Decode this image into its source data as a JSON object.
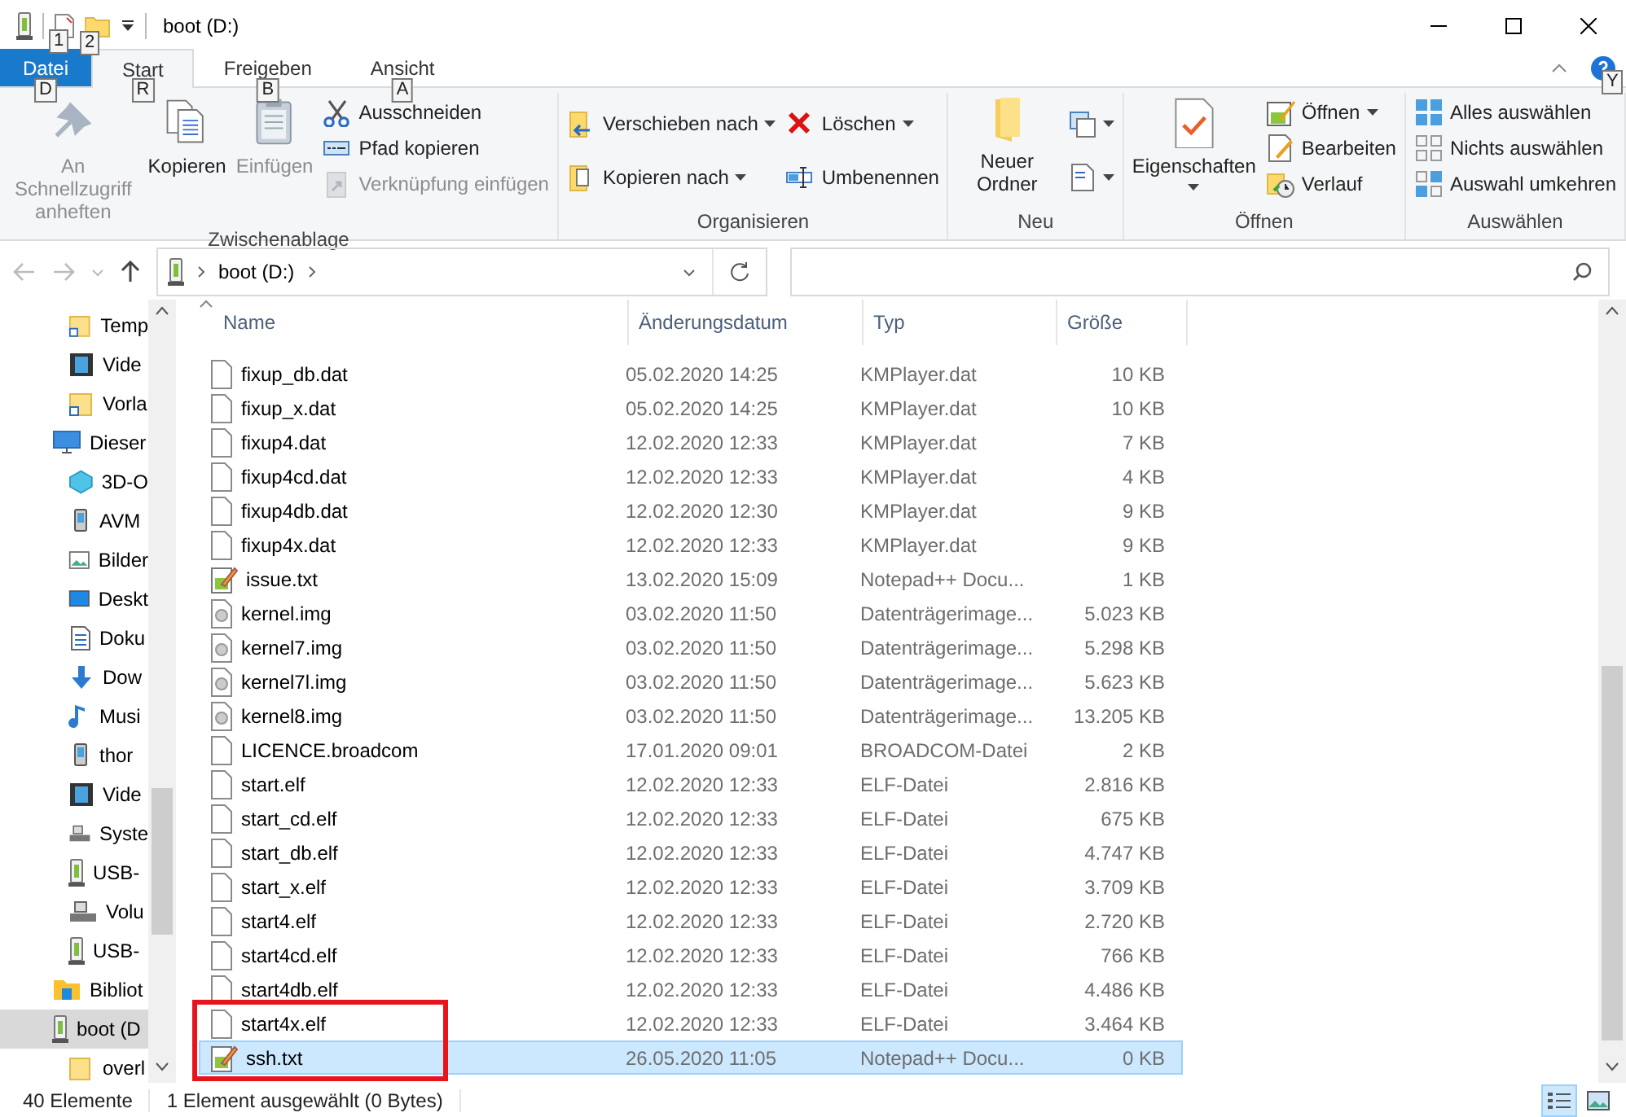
{
  "title_bar": {
    "title": "boot (D:)",
    "quick_access": [
      {
        "keytip": "1"
      },
      {
        "keytip": "2"
      }
    ]
  },
  "ribbon_tabs": [
    {
      "label": "Datei",
      "kind": "file",
      "selected": false,
      "keytip": "D"
    },
    {
      "label": "Start",
      "kind": "tab",
      "selected": true,
      "keytip": "R"
    },
    {
      "label": "Freigeben",
      "kind": "tab",
      "selected": false,
      "keytip": "B"
    },
    {
      "label": "Ansicht",
      "kind": "tab",
      "selected": false,
      "keytip": "A"
    }
  ],
  "help": {
    "keytip": "Y"
  },
  "ribbon_groups": [
    {
      "label": "Zwischenablage",
      "columns": [
        {
          "kind": "large",
          "buttons": [
            {
              "label": "An Schnellzugriff anheften",
              "disabled": true,
              "dropdown": false
            }
          ]
        },
        {
          "kind": "large",
          "buttons": [
            {
              "label": "Kopieren",
              "disabled": false,
              "dropdown": false
            }
          ]
        },
        {
          "kind": "large",
          "buttons": [
            {
              "label": "Einfügen",
              "disabled": true,
              "dropdown": false
            }
          ]
        },
        {
          "kind": "stack",
          "buttons": [
            {
              "label": "Ausschneiden",
              "disabled": false,
              "dropdown": false
            },
            {
              "label": "Pfad kopieren",
              "disabled": false,
              "dropdown": false
            },
            {
              "label": "Verknüpfung einfügen",
              "disabled": true,
              "dropdown": false
            }
          ]
        }
      ]
    },
    {
      "label": "Organisieren",
      "columns": [
        {
          "kind": "stack2",
          "buttons": [
            {
              "label": "Verschieben nach",
              "disabled": false,
              "dropdown": true
            },
            {
              "label": "Kopieren nach",
              "disabled": false,
              "dropdown": true
            }
          ]
        },
        {
          "kind": "stack2",
          "buttons": [
            {
              "label": "Löschen",
              "disabled": false,
              "dropdown": true
            },
            {
              "label": "Umbenennen",
              "disabled": false,
              "dropdown": false
            }
          ]
        }
      ]
    },
    {
      "label": "Neu",
      "columns": [
        {
          "kind": "large",
          "buttons": [
            {
              "label": "Neuer Ordner",
              "disabled": false,
              "dropdown": false
            }
          ]
        },
        {
          "kind": "stack2",
          "buttons": [
            {
              "disabled": false,
              "dropdown": true
            },
            {
              "disabled": false,
              "dropdown": true
            }
          ]
        }
      ]
    },
    {
      "label": "Öffnen",
      "columns": [
        {
          "kind": "large",
          "buttons": [
            {
              "label": "Eigenschaften",
              "disabled": false,
              "dropdown": true
            }
          ]
        },
        {
          "kind": "stack",
          "buttons": [
            {
              "label": "Öffnen",
              "disabled": false,
              "dropdown": true
            },
            {
              "label": "Bearbeiten",
              "disabled": false,
              "dropdown": false
            },
            {
              "label": "Verlauf",
              "disabled": false,
              "dropdown": false
            }
          ]
        }
      ]
    },
    {
      "label": "Auswählen",
      "columns": [
        {
          "kind": "stack",
          "buttons": [
            {
              "label": "Alles auswählen",
              "disabled": false,
              "dropdown": false
            },
            {
              "label": "Nichts auswählen",
              "disabled": false,
              "dropdown": false
            },
            {
              "label": "Auswahl umkehren",
              "disabled": false,
              "dropdown": false
            }
          ]
        }
      ]
    }
  ],
  "address": {
    "crumbs": [
      "boot (D:)"
    ]
  },
  "sidebar": {
    "quick_access_items": [
      {
        "label": "Temp",
        "kind": "shortcut",
        "selected": false
      },
      {
        "label": "Vide",
        "kind": "video",
        "selected": false
      },
      {
        "label": "Vorla",
        "kind": "shortcut",
        "selected": false
      }
    ],
    "items": [
      {
        "label": "Dieser",
        "kind": "pc",
        "selected": false,
        "children": [
          {
            "label": "3D-O",
            "kind": "cube",
            "selected": false
          },
          {
            "label": "AVM",
            "kind": "device",
            "selected": false
          },
          {
            "label": "Bilder",
            "kind": "pictures",
            "selected": false
          },
          {
            "label": "Deskt",
            "kind": "desktop",
            "selected": false
          },
          {
            "label": "Doku",
            "kind": "docs",
            "selected": false
          },
          {
            "label": "Dow",
            "kind": "download",
            "selected": false
          },
          {
            "label": "Musi",
            "kind": "music",
            "selected": false
          },
          {
            "label": "thor",
            "kind": "device",
            "selected": false
          },
          {
            "label": "Vide",
            "kind": "video",
            "selected": false
          },
          {
            "label": "Syste",
            "kind": "drive",
            "selected": false
          },
          {
            "label": "USB-",
            "kind": "usb",
            "selected": false
          },
          {
            "label": "Volu",
            "kind": "drive",
            "selected": false
          },
          {
            "label": "USB-",
            "kind": "usb",
            "selected": false
          }
        ]
      },
      {
        "label": "Bibliot",
        "kind": "library",
        "selected": false
      },
      {
        "label": "boot (D",
        "kind": "usb",
        "selected": true,
        "children": [
          {
            "label": "overl",
            "kind": "folder",
            "selected": false
          }
        ]
      }
    ]
  },
  "table": {
    "columns": [
      "Name",
      "Änderungsdatum",
      "Typ",
      "Größe"
    ],
    "rows": [
      {
        "kind": "file",
        "name": "fixup_db.dat",
        "date": "05.02.2020 14:25",
        "type": "KMPlayer.dat",
        "size": "10 KB",
        "selected": false,
        "marked": false
      },
      {
        "kind": "file",
        "name": "fixup_x.dat",
        "date": "05.02.2020 14:25",
        "type": "KMPlayer.dat",
        "size": "10 KB",
        "selected": false,
        "marked": false
      },
      {
        "kind": "file",
        "name": "fixup4.dat",
        "date": "12.02.2020 12:33",
        "type": "KMPlayer.dat",
        "size": "7 KB",
        "selected": false,
        "marked": false
      },
      {
        "kind": "file",
        "name": "fixup4cd.dat",
        "date": "12.02.2020 12:33",
        "type": "KMPlayer.dat",
        "size": "4 KB",
        "selected": false,
        "marked": false
      },
      {
        "kind": "file",
        "name": "fixup4db.dat",
        "date": "12.02.2020 12:30",
        "type": "KMPlayer.dat",
        "size": "9 KB",
        "selected": false,
        "marked": false
      },
      {
        "kind": "file",
        "name": "fixup4x.dat",
        "date": "12.02.2020 12:33",
        "type": "KMPlayer.dat",
        "size": "9 KB",
        "selected": false,
        "marked": false
      },
      {
        "kind": "text",
        "name": "issue.txt",
        "date": "13.02.2020 15:09",
        "type": "Notepad++ Docu...",
        "size": "1 KB",
        "selected": false,
        "marked": false
      },
      {
        "kind": "image",
        "name": "kernel.img",
        "date": "03.02.2020 11:50",
        "type": "Datenträgerimage...",
        "size": "5.023 KB",
        "selected": false,
        "marked": false
      },
      {
        "kind": "image",
        "name": "kernel7.img",
        "date": "03.02.2020 11:50",
        "type": "Datenträgerimage...",
        "size": "5.298 KB",
        "selected": false,
        "marked": false
      },
      {
        "kind": "image",
        "name": "kernel7l.img",
        "date": "03.02.2020 11:50",
        "type": "Datenträgerimage...",
        "size": "5.623 KB",
        "selected": false,
        "marked": false
      },
      {
        "kind": "image",
        "name": "kernel8.img",
        "date": "03.02.2020 11:50",
        "type": "Datenträgerimage...",
        "size": "13.205 KB",
        "selected": false,
        "marked": false
      },
      {
        "kind": "file",
        "name": "LICENCE.broadcom",
        "date": "17.01.2020 09:01",
        "type": "BROADCOM-Datei",
        "size": "2 KB",
        "selected": false,
        "marked": false
      },
      {
        "kind": "file",
        "name": "start.elf",
        "date": "12.02.2020 12:33",
        "type": "ELF-Datei",
        "size": "2.816 KB",
        "selected": false,
        "marked": false
      },
      {
        "kind": "file",
        "name": "start_cd.elf",
        "date": "12.02.2020 12:33",
        "type": "ELF-Datei",
        "size": "675 KB",
        "selected": false,
        "marked": false
      },
      {
        "kind": "file",
        "name": "start_db.elf",
        "date": "12.02.2020 12:33",
        "type": "ELF-Datei",
        "size": "4.747 KB",
        "selected": false,
        "marked": false
      },
      {
        "kind": "file",
        "name": "start_x.elf",
        "date": "12.02.2020 12:33",
        "type": "ELF-Datei",
        "size": "3.709 KB",
        "selected": false,
        "marked": false
      },
      {
        "kind": "file",
        "name": "start4.elf",
        "date": "12.02.2020 12:33",
        "type": "ELF-Datei",
        "size": "2.720 KB",
        "selected": false,
        "marked": false
      },
      {
        "kind": "file",
        "name": "start4cd.elf",
        "date": "12.02.2020 12:33",
        "type": "ELF-Datei",
        "size": "766 KB",
        "selected": false,
        "marked": false
      },
      {
        "kind": "file",
        "name": "start4db.elf",
        "date": "12.02.2020 12:33",
        "type": "ELF-Datei",
        "size": "4.486 KB",
        "selected": false,
        "marked": false
      },
      {
        "kind": "file",
        "name": "start4x.elf",
        "date": "12.02.2020 12:33",
        "type": "ELF-Datei",
        "size": "3.464 KB",
        "selected": false,
        "marked": true
      },
      {
        "kind": "text",
        "name": "ssh.txt",
        "date": "26.05.2020 11:05",
        "type": "Notepad++ Docu...",
        "size": "0 KB",
        "selected": true,
        "marked": true
      }
    ]
  },
  "status_bar": {
    "count": "40 Elemente",
    "selection": "1 Element ausgewählt (0 Bytes)",
    "views": [
      {
        "selected": true
      },
      {
        "selected": false
      }
    ]
  }
}
